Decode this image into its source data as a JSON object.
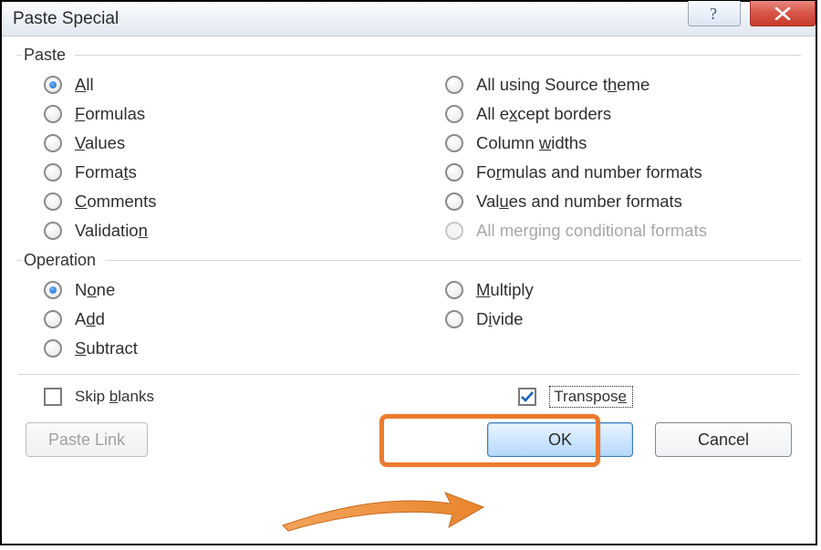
{
  "title": "Paste Special",
  "groups": {
    "paste": {
      "legend": "Paste",
      "left": [
        {
          "label_html": "<span class='ul'>A</span>ll",
          "selected": true,
          "name": "radio-all"
        },
        {
          "label_html": "<span class='ul'>F</span>ormulas",
          "name": "radio-formulas"
        },
        {
          "label_html": "<span class='ul'>V</span>alues",
          "name": "radio-values"
        },
        {
          "label_html": "Forma<span class='ul'>t</span>s",
          "name": "radio-formats"
        },
        {
          "label_html": "<span class='ul'>C</span>omments",
          "name": "radio-comments"
        },
        {
          "label_html": "Validatio<span class='ul'>n</span>",
          "name": "radio-validation"
        }
      ],
      "right": [
        {
          "label_html": "All using Source t<span class='ul'>h</span>eme",
          "name": "radio-source-theme"
        },
        {
          "label_html": "All e<span class='ul'>x</span>cept borders",
          "name": "radio-except-borders"
        },
        {
          "label_html": "Column <span class='ul'>w</span>idths",
          "name": "radio-column-widths"
        },
        {
          "label_html": "Fo<span class='ul'>r</span>mulas and number formats",
          "name": "radio-formulas-numfmt"
        },
        {
          "label_html": "Val<span class='ul'>u</span>es and number formats",
          "name": "radio-values-numfmt"
        },
        {
          "label_html": "All mer<span class='ul'>g</span>ing conditional formats",
          "name": "radio-merge-condfmt",
          "disabled": true
        }
      ]
    },
    "operation": {
      "legend": "Operation",
      "left": [
        {
          "label_html": "N<span class='ul'>o</span>ne",
          "selected": true,
          "name": "radio-none"
        },
        {
          "label_html": "A<span class='ul'>d</span>d",
          "name": "radio-add"
        },
        {
          "label_html": "<span class='ul'>S</span>ubtract",
          "name": "radio-subtract"
        }
      ],
      "right": [
        {
          "label_html": "<span class='ul'>M</span>ultiply",
          "name": "radio-multiply"
        },
        {
          "label_html": "D<span class='ul'>i</span>vide",
          "name": "radio-divide"
        }
      ]
    }
  },
  "checks": {
    "skip_blanks": {
      "label_html": "Skip <span class='ul'>b</span>lanks",
      "checked": false
    },
    "transpose": {
      "label_html": "Transpos<span class='ul'>e</span>",
      "checked": true
    }
  },
  "buttons": {
    "paste_link": "Paste Link",
    "ok": "OK",
    "cancel": "Cancel"
  }
}
